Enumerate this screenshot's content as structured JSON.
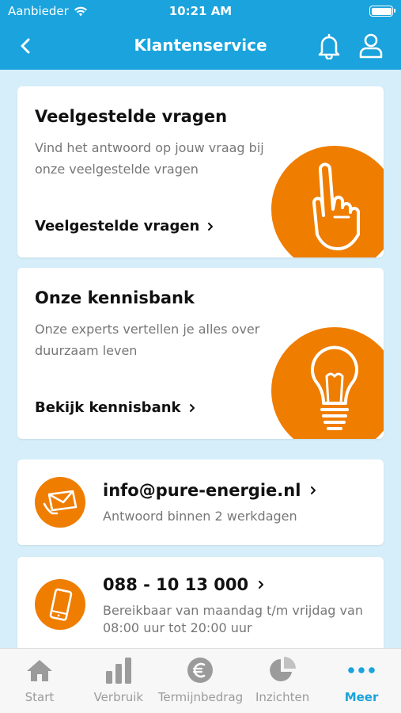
{
  "status": {
    "carrier": "Aanbieder",
    "time": "10:21 AM"
  },
  "header": {
    "title": "Klantenservice"
  },
  "faq": {
    "title": "Veelgestelde vragen",
    "description": "Vind het antwoord op jouw vraag bij onze veelgestelde vragen",
    "link": "Veelgestelde vragen"
  },
  "knowledge": {
    "title": "Onze kennisbank",
    "description": "Onze experts vertellen je alles over duurzaam leven",
    "link": "Bekijk kennisbank"
  },
  "email": {
    "address": "info@pure-energie.nl",
    "note": "Antwoord binnen 2 werkdagen"
  },
  "phone": {
    "number": "088 - 10 13 000",
    "note": "Bereikbaar van maandag t/m vrijdag van 08:00 uur tot 20:00 uur"
  },
  "tabs": [
    {
      "label": "Start",
      "icon": "home-icon"
    },
    {
      "label": "Verbruik",
      "icon": "bar-chart-icon"
    },
    {
      "label": "Termijnbedrag",
      "icon": "euro-icon"
    },
    {
      "label": "Inzichten",
      "icon": "pie-chart-icon"
    },
    {
      "label": "Meer",
      "icon": "more-icon",
      "active": true
    }
  ],
  "colors": {
    "header": "#1aa3dc",
    "accent": "#ef7d00",
    "background": "#d6eef9",
    "tab_active": "#1aa3dc",
    "tab_inactive": "#9b9b9b"
  }
}
